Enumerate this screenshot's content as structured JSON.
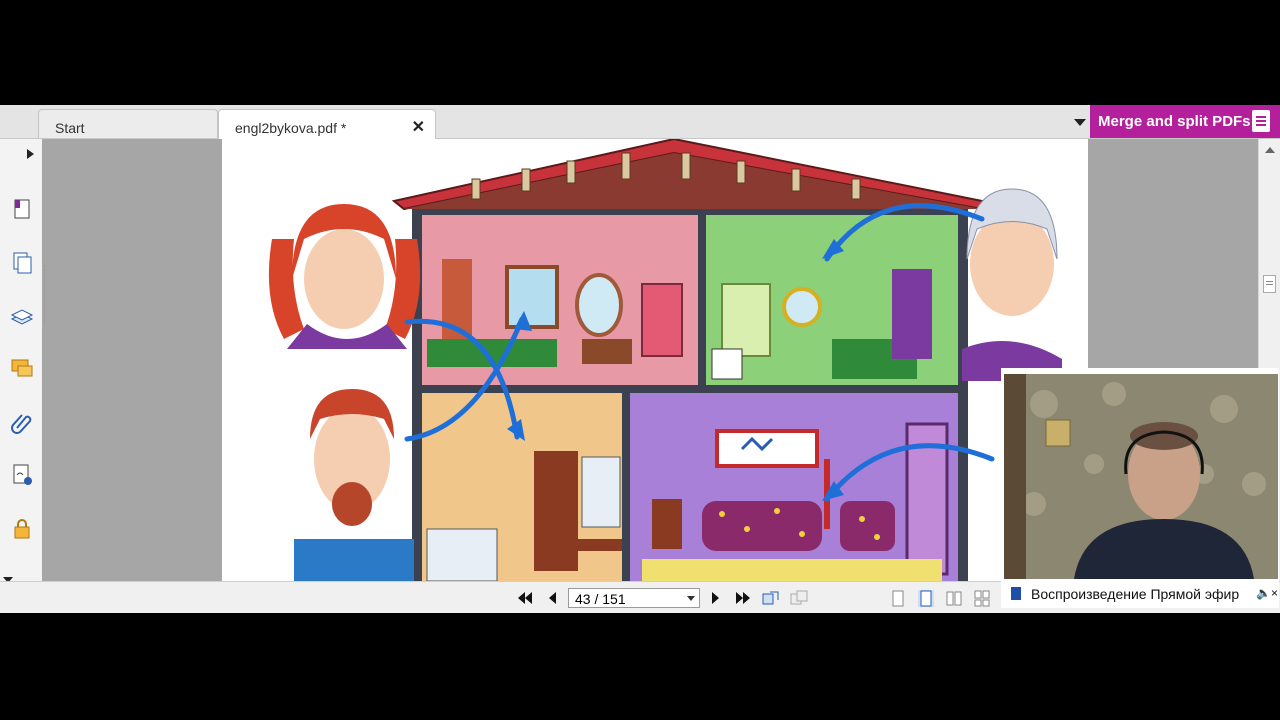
{
  "tabs": [
    {
      "label": "Start"
    },
    {
      "label": "engl2bykova.pdf *"
    }
  ],
  "promo": {
    "label": "Merge and split PDFs",
    "color": "#b4209b"
  },
  "navigation": {
    "page_indicator": "43 / 151"
  },
  "sidebar": {
    "icons": [
      "pages-icon",
      "thumbnails-icon",
      "layers-icon",
      "comments-icon",
      "attachments-icon",
      "signatures-icon",
      "security-icon"
    ]
  },
  "webcam": {
    "caption": "Воспроизведение Прямой эфир"
  }
}
